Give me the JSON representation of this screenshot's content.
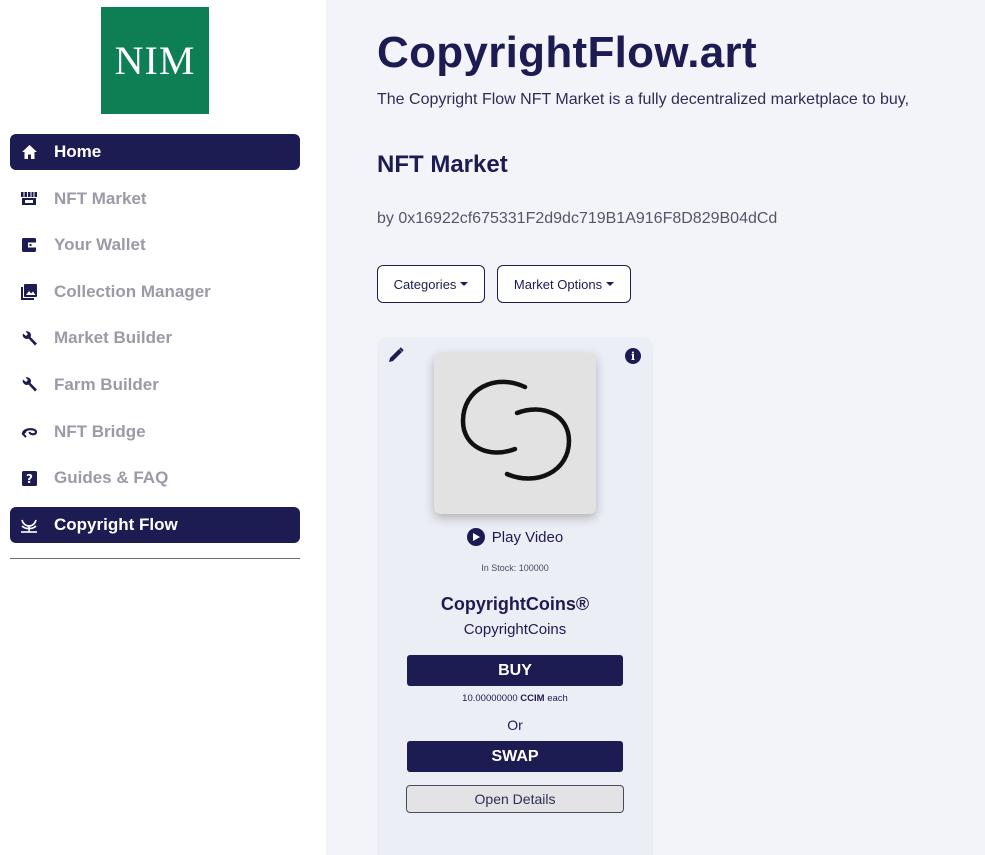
{
  "logo": {
    "text": "NIM",
    "color": "#0e7f55"
  },
  "sidebar": {
    "items": [
      {
        "label": "Home",
        "icon": "home-icon",
        "active": true
      },
      {
        "label": "NFT Market",
        "icon": "store-icon",
        "active": false
      },
      {
        "label": "Your Wallet",
        "icon": "wallet-icon",
        "active": false
      },
      {
        "label": "Collection Manager",
        "icon": "image-collection-icon",
        "active": false
      },
      {
        "label": "Market Builder",
        "icon": "wrench-icon",
        "active": false
      },
      {
        "label": "Farm Builder",
        "icon": "wrench-icon",
        "active": false
      },
      {
        "label": "NFT Bridge",
        "icon": "bridge-icon",
        "active": false
      },
      {
        "label": "Guides & FAQ",
        "icon": "question-icon",
        "active": false
      },
      {
        "label": "Copyright Flow",
        "icon": "sprout-icon",
        "active": true
      }
    ]
  },
  "main": {
    "title": "CopyrightFlow.art",
    "description": "The Copyright Flow NFT Market is a fully decentralized marketplace to buy,",
    "section_title": "NFT Market",
    "owner": "by 0x16922cf675331F2d9dc719B1A916F8D829B04dCd",
    "dropdowns": {
      "categories": "Categories",
      "market_options": "Market Options"
    }
  },
  "card": {
    "play_label": "Play Video",
    "stock": "In Stock: 100000",
    "name": "CopyrightCoins®",
    "collection": "CopyrightCoins",
    "buy_label": "BUY",
    "price_amount": "10.00000000",
    "price_unit": "CCIM",
    "price_suffix": "each",
    "or_label": "Or",
    "swap_label": "SWAP",
    "details_label": "Open Details",
    "info_symbol": "i"
  },
  "colors": {
    "primary": "#1c1b52",
    "muted": "#9b9aa6",
    "main_bg": "#f3f4f9",
    "card_bg": "#eceef6"
  }
}
